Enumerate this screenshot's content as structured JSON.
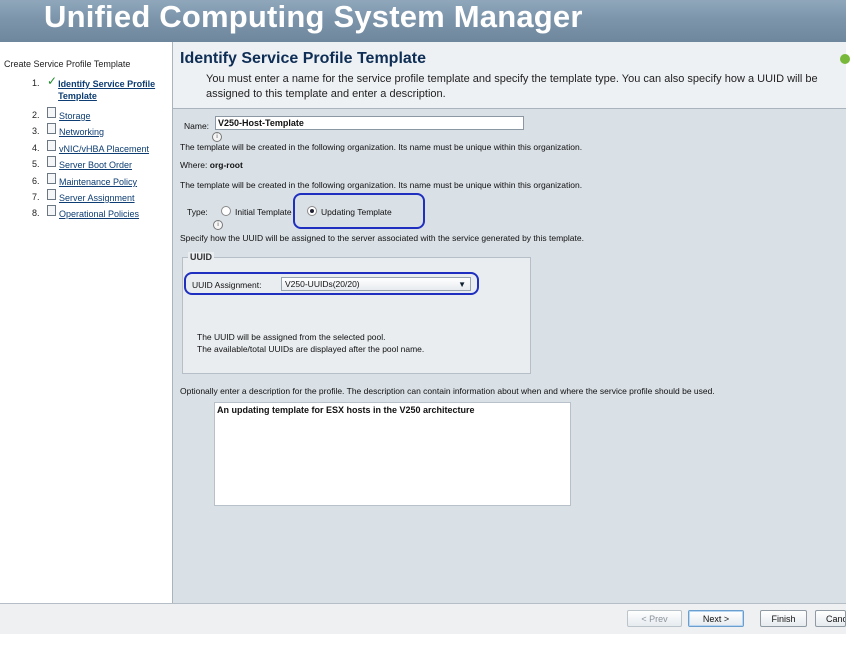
{
  "app": {
    "title": "Unified Computing System Manager"
  },
  "wizard": {
    "title": "Create Service Profile Template",
    "steps": [
      {
        "num": "1.",
        "label": "Identify Service Profile Template",
        "current": true
      },
      {
        "num": "2.",
        "label": "Storage"
      },
      {
        "num": "3.",
        "label": "Networking"
      },
      {
        "num": "4.",
        "label": "vNIC/vHBA Placement"
      },
      {
        "num": "5.",
        "label": "Server Boot Order"
      },
      {
        "num": "6.",
        "label": "Maintenance Policy"
      },
      {
        "num": "7.",
        "label": "Server Assignment"
      },
      {
        "num": "8.",
        "label": "Operational Policies"
      }
    ],
    "icons": {
      "completed": "check-icon",
      "pending": "document-icon"
    }
  },
  "page": {
    "title": "Identify Service Profile Template",
    "subtitle": "You must enter a name for the service profile template and specify the template type. You can also specify how a UUID will be assigned to this template and enter a description."
  },
  "form": {
    "name_label": "Name:",
    "name_value": "V250-Host-Template",
    "org_note": "The template will be created in the following organization. Its name must be unique within this organization.",
    "where_label": "Where:",
    "where_value": "org-root",
    "org_note2": "The template will be created in the following organization. Its name must be unique within this organization.",
    "type_label": "Type:",
    "type_options": [
      {
        "label": "Initial Template",
        "selected": false
      },
      {
        "label": "Updating Template",
        "selected": true
      }
    ],
    "uuid_note": "Specify how the UUID will be assigned to the server associated with the service generated by this template.",
    "uuid_group_label": "UUID",
    "uuid_assignment_label": "UUID Assignment:",
    "uuid_assignment_value": "V250-UUIDs(20/20)",
    "uuid_info_1": "The UUID will be assigned from the selected pool.",
    "uuid_info_2": "The available/total UUIDs are displayed after the pool name.",
    "description_note": "Optionally enter a description for the profile. The description can contain information about when and where the service profile should be used.",
    "description_value": "An updating template for ESX hosts in the V250 architecture"
  },
  "footer": {
    "prev": "< Prev",
    "next": "Next >",
    "finish": "Finish",
    "cancel": "Cancel"
  },
  "colors": {
    "header": "#7d95ab",
    "annotation": "#1f2fbf",
    "link": "#0d3d73"
  }
}
